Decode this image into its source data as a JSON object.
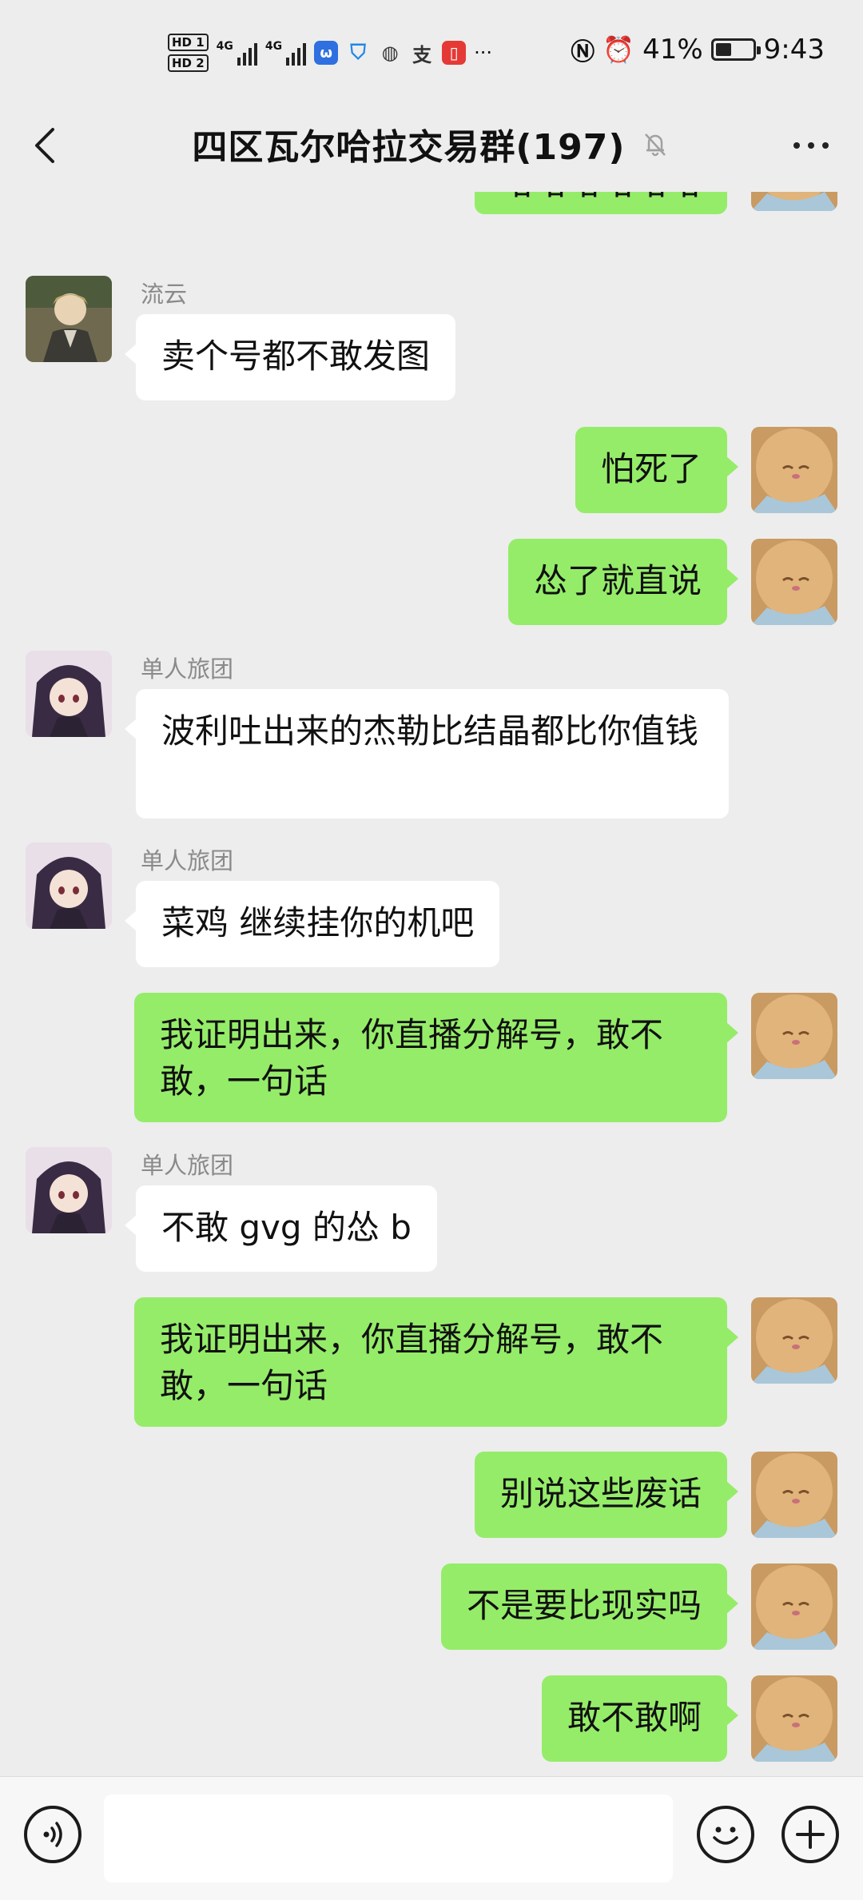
{
  "status_bar": {
    "network_badges": [
      "HD 1",
      "HD 2"
    ],
    "signal_labels": [
      "4G",
      "4G"
    ],
    "battery_percent": "41%",
    "battery_level": 0.41,
    "time": "9:43",
    "more_notifications": "···"
  },
  "header": {
    "title": "四区瓦尔哈拉交易群(197)",
    "back_icon": "chevron-left-icon",
    "mute_icon": "bell-muted-icon",
    "more_icon": "more-horizontal-icon"
  },
  "messages": [
    {
      "side": "right",
      "text": "哈哈哈哈哈哈",
      "avatar": "cat-avatar"
    },
    {
      "side": "left",
      "sender": "流云",
      "text": "卖个号都不敢发图",
      "avatar": "anime-man-avatar"
    },
    {
      "side": "right",
      "text": "怕死了",
      "avatar": "cat-avatar"
    },
    {
      "side": "right",
      "text": "怂了就直说",
      "avatar": "cat-avatar"
    },
    {
      "side": "left",
      "sender": "单人旅团",
      "text": "波利吐出来的杰勒比结晶都比你值钱",
      "avatar": "anime-girl-avatar"
    },
    {
      "side": "left",
      "sender": "单人旅团",
      "text": "菜鸡 继续挂你的机吧",
      "avatar": "anime-girl-avatar"
    },
    {
      "side": "right",
      "text": "我证明出来，你直播分解号，敢不敢，一句话",
      "avatar": "cat-avatar"
    },
    {
      "side": "left",
      "sender": "单人旅团",
      "text": "不敢 gvg 的怂 b",
      "avatar": "anime-girl-avatar"
    },
    {
      "side": "right",
      "text": "我证明出来，你直播分解号，敢不敢，一句话",
      "avatar": "cat-avatar"
    },
    {
      "side": "right",
      "text": "别说这些废话",
      "avatar": "cat-avatar"
    },
    {
      "side": "right",
      "text": "不是要比现实吗",
      "avatar": "cat-avatar"
    },
    {
      "side": "right",
      "text": "敢不敢啊",
      "avatar": "cat-avatar"
    }
  ],
  "input_bar": {
    "voice_icon": "voice-icon",
    "input_value": "",
    "emoji_icon": "emoji-icon",
    "plus_icon": "plus-icon"
  },
  "colors": {
    "background": "#ededed",
    "outgoing_bubble": "#95ec69",
    "incoming_bubble": "#ffffff",
    "sender_name": "#8a8a8a"
  }
}
